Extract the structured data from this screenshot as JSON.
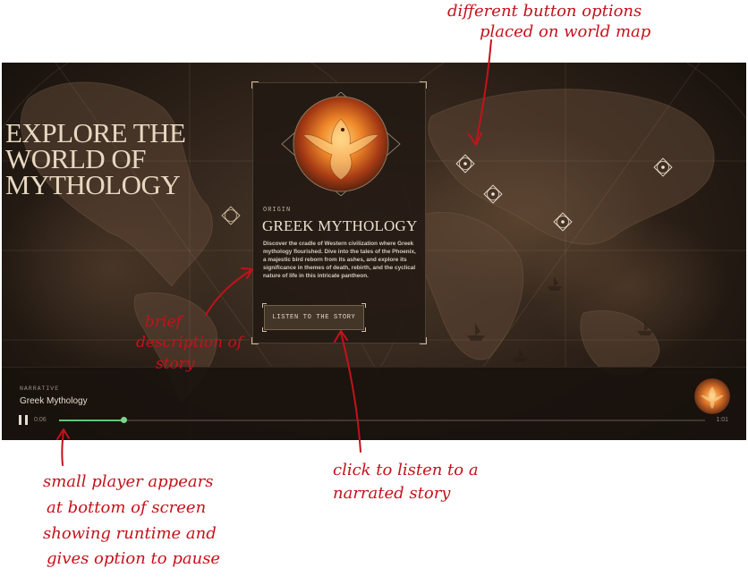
{
  "annotations": {
    "map_buttons": [
      "different button options",
      "placed on world map"
    ],
    "description": [
      "brief",
      "description of",
      "story"
    ],
    "listen": [
      "click to listen to a",
      "narrated story"
    ],
    "player": [
      "small player appears",
      "at bottom of screen",
      "showing runtime and",
      "gives option to pause"
    ]
  },
  "hero": {
    "title_lines": [
      "EXPLORE THE",
      "WORLD OF",
      "MYTHOLOGY"
    ]
  },
  "map_markers": [
    {
      "id": "west"
    },
    {
      "id": "north-africa"
    },
    {
      "id": "middle-east"
    },
    {
      "id": "india"
    },
    {
      "id": "east-asia"
    }
  ],
  "story": {
    "eyebrow": "ORIGIN",
    "title": "GREEK MYTHOLOGY",
    "description": "Discover the cradle of Western civilization where Greek mythology flourished. Dive into the tales of the Phoenix, a majestic bird reborn from its ashes, and explore its significance in themes of death, rebirth, and the cyclical nature of life in this intricate pantheon.",
    "button_label": "LISTEN TO THE STORY",
    "image_icon": "phoenix-image"
  },
  "player": {
    "eyebrow": "NARRATIVE",
    "title": "Greek Mythology",
    "elapsed": "0:06",
    "total": "1:01",
    "progress": 0.1,
    "pause_icon": "pause-icon",
    "accent_color": "#67c27a"
  },
  "colors": {
    "annotation": "#c4121b",
    "background": "#2e2219",
    "text": "#e7d8c1"
  }
}
